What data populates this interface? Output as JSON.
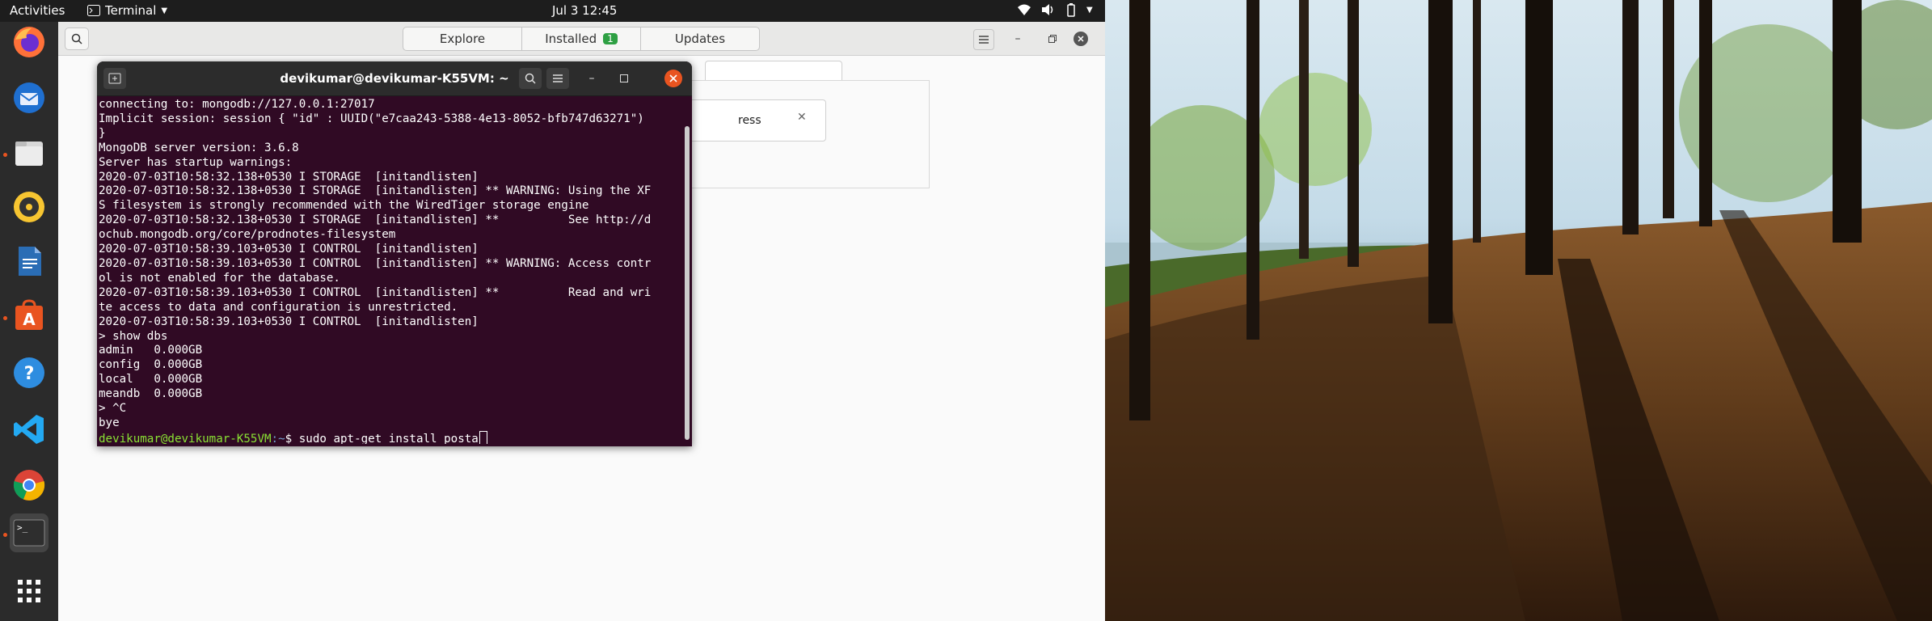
{
  "topbar": {
    "activities": "Activities",
    "app_name": "Terminal",
    "clock": "Jul 3  12:45"
  },
  "dock": {
    "items": [
      "firefox-icon",
      "thunderbird-icon",
      "files-icon",
      "rhythmbox-icon",
      "writer-icon",
      "software-icon",
      "help-icon",
      "vscode-icon",
      "chrome-icon",
      "terminal-icon",
      "show-apps-icon"
    ]
  },
  "software": {
    "tabs": [
      {
        "label": "Explore"
      },
      {
        "label": "Installed",
        "badge": "1"
      },
      {
        "label": "Updates"
      }
    ],
    "notice_text": "ress"
  },
  "terminal": {
    "title": "devikumar@devikumar-K55VM: ~",
    "lines": [
      "connecting to: mongodb://127.0.0.1:27017",
      "Implicit session: session { \"id\" : UUID(\"e7caa243-5388-4e13-8052-bfb747d63271\")",
      "}",
      "MongoDB server version: 3.6.8",
      "Server has startup warnings:",
      "2020-07-03T10:58:32.138+0530 I STORAGE  [initandlisten]",
      "2020-07-03T10:58:32.138+0530 I STORAGE  [initandlisten] ** WARNING: Using the XF",
      "S filesystem is strongly recommended with the WiredTiger storage engine",
      "2020-07-03T10:58:32.138+0530 I STORAGE  [initandlisten] **          See http://d",
      "ochub.mongodb.org/core/prodnotes-filesystem",
      "2020-07-03T10:58:39.103+0530 I CONTROL  [initandlisten]",
      "2020-07-03T10:58:39.103+0530 I CONTROL  [initandlisten] ** WARNING: Access contr",
      "ol is not enabled for the database.",
      "2020-07-03T10:58:39.103+0530 I CONTROL  [initandlisten] **          Read and wri",
      "te access to data and configuration is unrestricted.",
      "2020-07-03T10:58:39.103+0530 I CONTROL  [initandlisten]",
      "> show dbs",
      "admin   0.000GB",
      "config  0.000GB",
      "local   0.000GB",
      "meandb  0.000GB",
      "> ^C",
      "bye"
    ],
    "prompt_user": "devikumar@devikumar-K55VM",
    "prompt_path": ":~",
    "prompt_symbol": "$ ",
    "command": "sudo apt-get install posta"
  }
}
